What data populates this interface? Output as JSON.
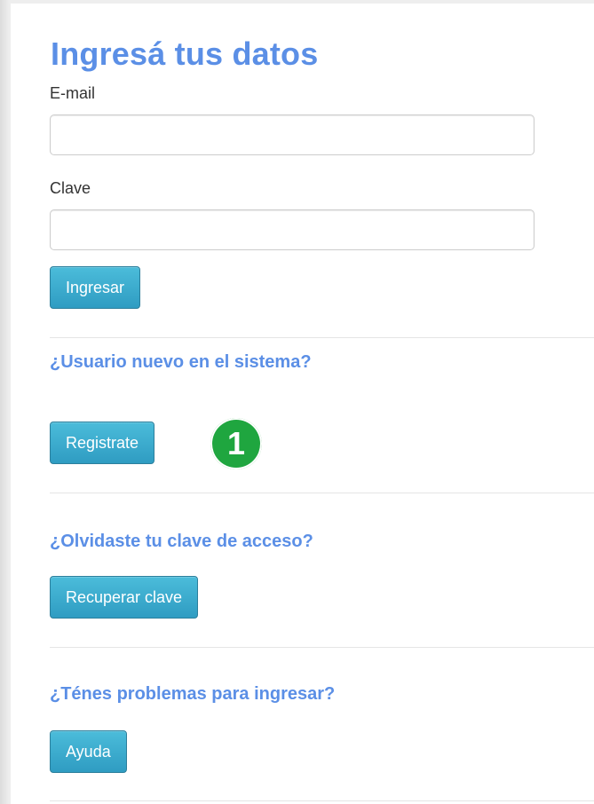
{
  "login": {
    "title": "Ingresá tus datos",
    "email_label": "E-mail",
    "email_value": "",
    "password_label": "Clave",
    "password_value": "",
    "submit_label": "Ingresar"
  },
  "register": {
    "heading": "¿Usuario nuevo en el sistema?",
    "button_label": "Registrate",
    "step_badge": "1"
  },
  "recover": {
    "heading": "¿Olvidaste tu clave de acceso?",
    "button_label": "Recuperar clave"
  },
  "help": {
    "heading": "¿Ténes problemas para ingresar?",
    "button_label": "Ayuda"
  },
  "colors": {
    "heading_blue": "#5b8fe6",
    "button_blue": "#2f9cc2",
    "badge_green": "#1fa63f"
  }
}
